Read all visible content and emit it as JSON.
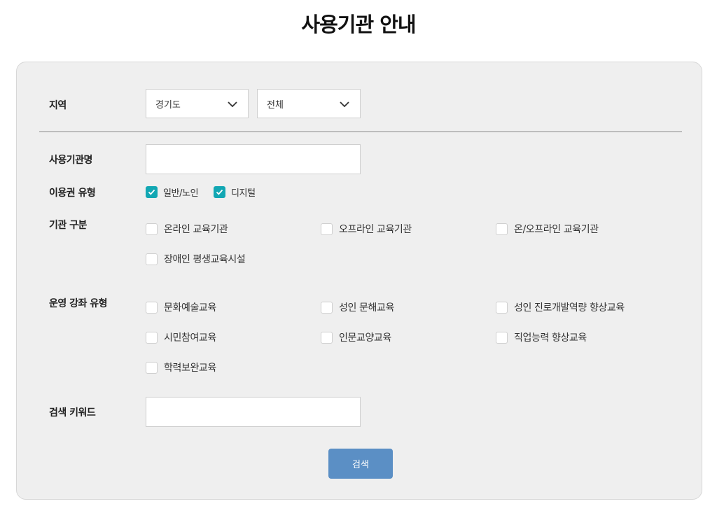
{
  "title": "사용기관 안내",
  "region": {
    "label": "지역",
    "province": "경기도",
    "city": "전체"
  },
  "institution_name": {
    "label": "사용기관명",
    "value": ""
  },
  "voucher_type": {
    "label": "이용권 유형",
    "options": [
      {
        "label": "일반/노인",
        "checked": true
      },
      {
        "label": "디지털",
        "checked": true
      }
    ]
  },
  "institution_category": {
    "label": "기관 구분",
    "options": [
      "온라인 교육기관",
      "오프라인 교육기관",
      "온/오프라인 교육기관",
      "장애인 평생교육시설"
    ]
  },
  "course_type": {
    "label": "운영 강좌 유형",
    "options": [
      "문화예술교육",
      "성인 문해교육",
      "성인 진로개발역량 향상교육",
      "시민참여교육",
      "인문교양교육",
      "직업능력 향상교육",
      "학력보완교육"
    ]
  },
  "keyword": {
    "label": "검색 키워드",
    "value": ""
  },
  "search_button": "검색",
  "colors": {
    "accent": "#12a7b3",
    "button": "#5b8fc5",
    "panel": "#efefef"
  }
}
